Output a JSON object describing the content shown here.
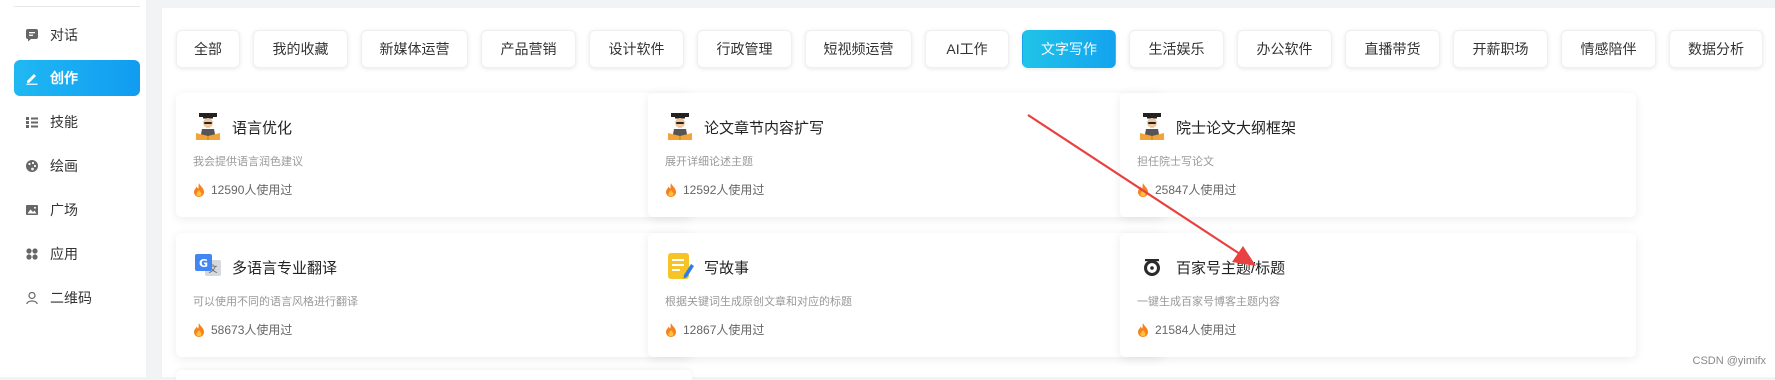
{
  "sidebar": {
    "items": [
      {
        "label": "对话",
        "icon": "chat-icon"
      },
      {
        "label": "创作",
        "icon": "pen-icon",
        "active": true
      },
      {
        "label": "技能",
        "icon": "list-icon"
      },
      {
        "label": "绘画",
        "icon": "palette-icon"
      },
      {
        "label": "广场",
        "icon": "image-icon"
      },
      {
        "label": "应用",
        "icon": "apps-icon"
      },
      {
        "label": "二维码",
        "icon": "user-icon"
      }
    ]
  },
  "tabs": [
    {
      "label": "全部"
    },
    {
      "label": "我的收藏"
    },
    {
      "label": "新媒体运营"
    },
    {
      "label": "产品营销"
    },
    {
      "label": "设计软件"
    },
    {
      "label": "行政管理"
    },
    {
      "label": "短视频运营"
    },
    {
      "label": "AI工作"
    },
    {
      "label": "文字写作",
      "active": true
    },
    {
      "label": "生活娱乐"
    },
    {
      "label": "办公软件"
    },
    {
      "label": "直播带货"
    },
    {
      "label": "开薪职场"
    },
    {
      "label": "情感陪伴"
    },
    {
      "label": "数据分析"
    }
  ],
  "cards": [
    {
      "title": "语言优化",
      "desc": "我会提供语言润色建议",
      "usage": "12590人使用过",
      "icon": "scholar-icon"
    },
    {
      "title": "论文章节内容扩写",
      "desc": "展开详细论述主题",
      "usage": "12592人使用过",
      "icon": "scholar-icon",
      "star": true
    },
    {
      "title": "院士论文大纲框架",
      "desc": "担任院士写论文",
      "usage": "25847人使用过",
      "icon": "scholar-icon"
    },
    {
      "title": "多语言专业翻译",
      "desc": "可以使用不同的语言风格进行翻译",
      "usage": "58673人使用过",
      "icon": "translate-icon"
    },
    {
      "title": "写故事",
      "desc": "根据关键词生成原创文章和对应的标题",
      "usage": "12867人使用过",
      "icon": "notepad-icon"
    },
    {
      "title": "百家号主题/标题",
      "desc": "一键生成百家号博客主题内容",
      "usage": "21584人使用过",
      "icon": "baijiahao-icon"
    }
  ],
  "colors": {
    "accent": "#13a3ef",
    "annotation_arrow": "#e8413f",
    "fire": "#f5811f"
  },
  "watermark": "CSDN @yimifx"
}
